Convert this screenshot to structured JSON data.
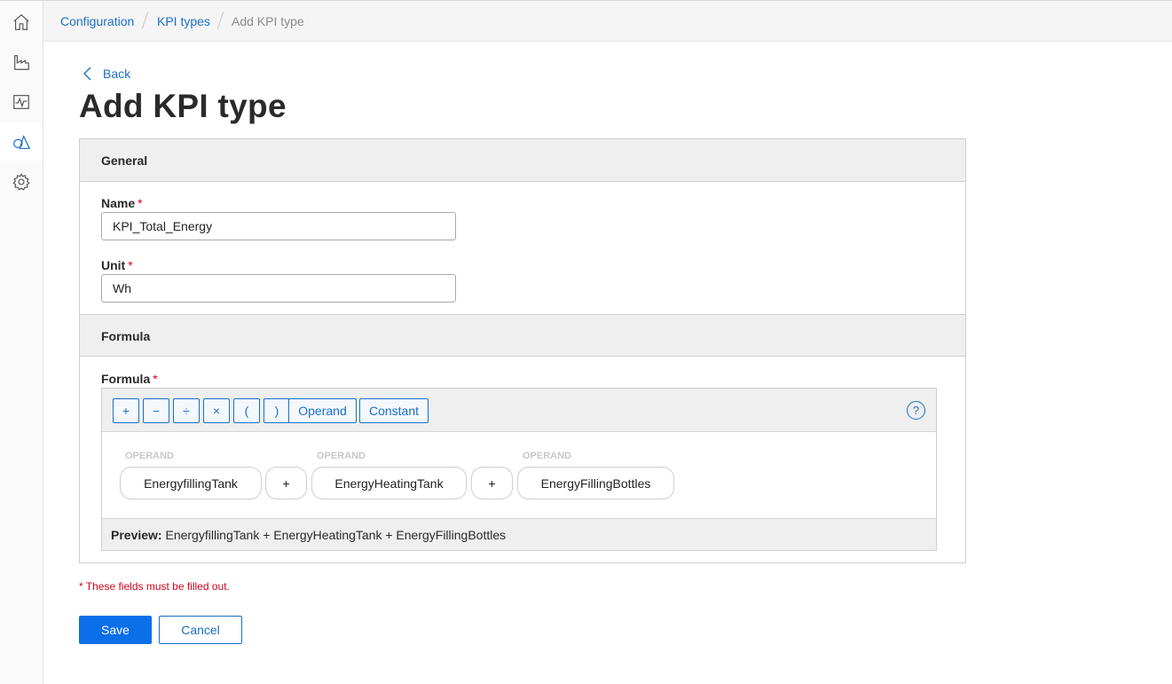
{
  "breadcrumb": {
    "items": [
      "Configuration",
      "KPI types"
    ],
    "current": "Add KPI type"
  },
  "back_label": "Back",
  "page_title": "Add KPI type",
  "sections": {
    "general": "General",
    "formula": "Formula"
  },
  "fields": {
    "name": {
      "label": "Name",
      "required_mark": "*",
      "value": "KPI_Total_Energy"
    },
    "unit": {
      "label": "Unit",
      "required_mark": "*",
      "value": "Wh"
    },
    "formula": {
      "label": "Formula",
      "required_mark": "*"
    }
  },
  "toolbar": {
    "buttons": [
      "+",
      "−",
      "÷",
      "×",
      "(",
      ")",
      "Operand",
      "Constant"
    ],
    "help": "?"
  },
  "formula_items": [
    {
      "kind": "operand",
      "caption": "OPERAND",
      "value": "EnergyfillingTank"
    },
    {
      "kind": "operator",
      "value": "+"
    },
    {
      "kind": "operand",
      "caption": "OPERAND",
      "value": "EnergyHeatingTank"
    },
    {
      "kind": "operator",
      "value": "+"
    },
    {
      "kind": "operand",
      "caption": "OPERAND",
      "value": "EnergyFillingBottles"
    }
  ],
  "preview": {
    "label": "Preview:",
    "text": "EnergyfillingTank + EnergyHeatingTank + EnergyFillingBottles"
  },
  "required_note": "* These fields must be filled out.",
  "actions": {
    "save": "Save",
    "cancel": "Cancel"
  },
  "colors": {
    "accent": "#1a6fc9",
    "primary_button": "#0a6fe8",
    "required": "#d0021b"
  },
  "icons": {
    "sidebar": [
      "home-icon",
      "factory-icon",
      "monitoring-icon",
      "shapes-icon",
      "gear-icon"
    ]
  }
}
